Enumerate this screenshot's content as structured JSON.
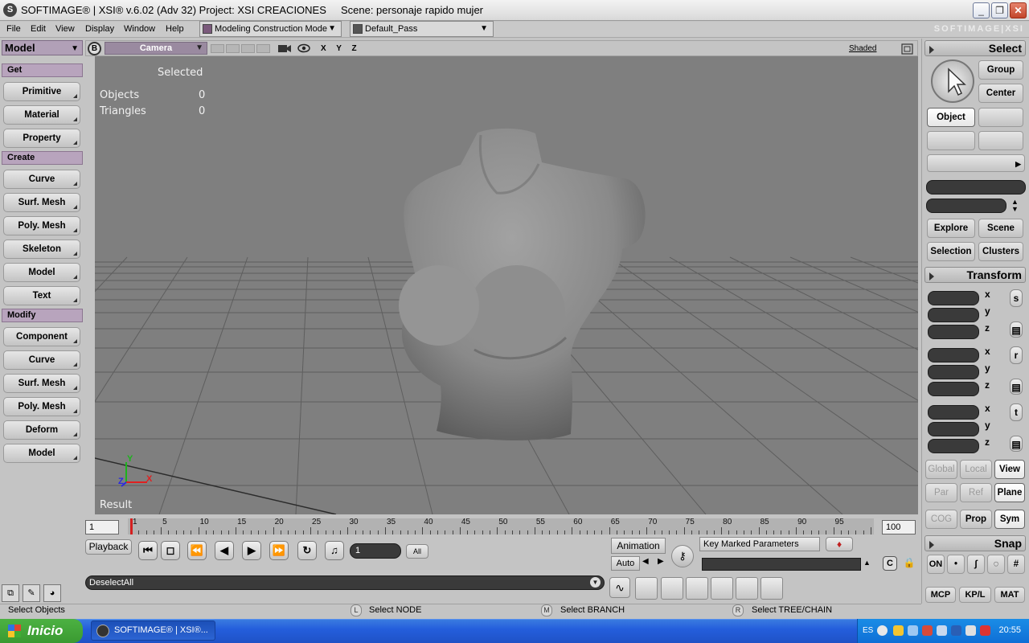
{
  "window": {
    "title": "SOFTIMAGE® | XSI® v.6.02 (Adv 32) Project: XSI CREACIONES     Scene: personaje rapido mujer",
    "minimize": "_",
    "maximize": "❐",
    "close": "✕"
  },
  "menu": [
    "File",
    "Edit",
    "View",
    "Display",
    "Window",
    "Help"
  ],
  "mode_combo": "Modeling Construction Mode",
  "pass_combo": "Default_Pass",
  "brand": "SOFTIMAGE|XSI",
  "left": {
    "module": "Model",
    "sections": [
      {
        "title": "Get",
        "items": [
          "Primitive",
          "Material",
          "Property"
        ]
      },
      {
        "title": "Create",
        "items": [
          "Curve",
          "Surf. Mesh",
          "Poly. Mesh",
          "Skeleton",
          "Model",
          "Text"
        ]
      },
      {
        "title": "Modify",
        "items": [
          "Component",
          "Curve",
          "Surf. Mesh",
          "Poly. Mesh",
          "Deform",
          "Model"
        ]
      }
    ]
  },
  "viewport": {
    "letter": "B",
    "camera": "Camera",
    "axes": "X Y Z",
    "shading": "Shaded",
    "info_header": "Selected",
    "rows": [
      {
        "label": "Objects",
        "value": "0"
      },
      {
        "label": "Triangles",
        "value": "0"
      }
    ],
    "footer": "Result",
    "gizmo_x": "X",
    "gizmo_y": "Y",
    "gizmo_z": "Z"
  },
  "timeline": {
    "start": "1",
    "end": "100",
    "labels": [
      "1",
      "5",
      "10",
      "15",
      "20",
      "25",
      "30",
      "35",
      "40",
      "45",
      "50",
      "55",
      "60",
      "65",
      "70",
      "75",
      "80",
      "85",
      "90",
      "95"
    ]
  },
  "playback": {
    "label": "Playback",
    "frame": "1",
    "all": "All",
    "animation": "Animation",
    "auto": "Auto",
    "key_marked": "Key Marked Parameters"
  },
  "command": {
    "value": "DeselectAll"
  },
  "status": {
    "left": "Select Objects",
    "l_key": "L",
    "l_text": "Select NODE",
    "m_key": "M",
    "m_text": "Select BRANCH",
    "r_key": "R",
    "r_text": "Select TREE/CHAIN"
  },
  "right": {
    "select_title": "Select",
    "group": "Group",
    "center": "Center",
    "object": "Object",
    "explore": "Explore",
    "scene": "Scene",
    "selection": "Selection",
    "clusters": "Clusters",
    "transform_title": "Transform",
    "x": "x",
    "y": "y",
    "z": "z",
    "s": "s",
    "r": "r",
    "t": "t",
    "global": "Global",
    "local": "Local",
    "view": "View",
    "par": "Par",
    "ref": "Ref",
    "plane": "Plane",
    "cog": "COG",
    "prop": "Prop",
    "sym": "Sym",
    "snap_title": "Snap",
    "on": "ON",
    "tabs": [
      "MCP",
      "KP/L",
      "MAT"
    ]
  },
  "taskbar": {
    "start": "Inicio",
    "task": "SOFTIMAGE® | XSI®...",
    "lang": "ES",
    "clock": "20:55"
  },
  "colors": {
    "accent_purple": "#b8a4bd",
    "viewport_bg": "#7f7f7f",
    "timeline_marker": "#d42020"
  }
}
